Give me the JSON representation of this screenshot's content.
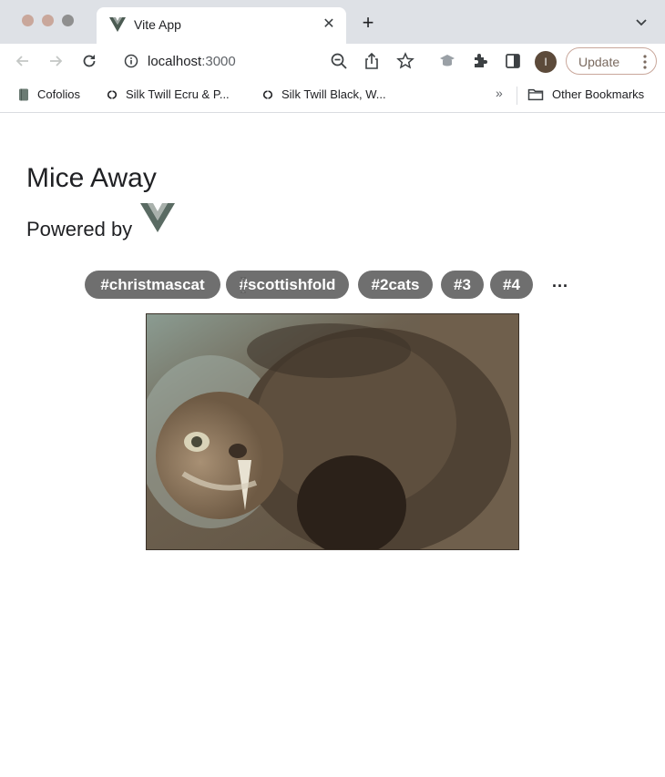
{
  "browser": {
    "tab": {
      "title": "Vite App"
    },
    "address": {
      "host": "localhost",
      "port": ":3000"
    },
    "update_label": "Update",
    "avatar_initial": "I",
    "bookmarks": [
      {
        "label": "Cofolios",
        "icon": "book-icon"
      },
      {
        "label": "Silk Twill Ecru & P...",
        "icon": "chanel-icon"
      },
      {
        "label": "Silk Twill Black, W...",
        "icon": "chanel-icon"
      }
    ],
    "bookmarks_overflow": "»",
    "other_bookmarks": "Other Bookmarks"
  },
  "app": {
    "title": "Mice Away",
    "powered_by": "Powered by",
    "tags": [
      "#christmascat",
      "#scottishfold",
      "#2cats",
      "#3",
      "#4"
    ],
    "more": "..."
  },
  "colors": {
    "tag_bg": "#6f6f6f",
    "tab_strip": "#dee1e6",
    "update_border": "#c9a79b"
  }
}
